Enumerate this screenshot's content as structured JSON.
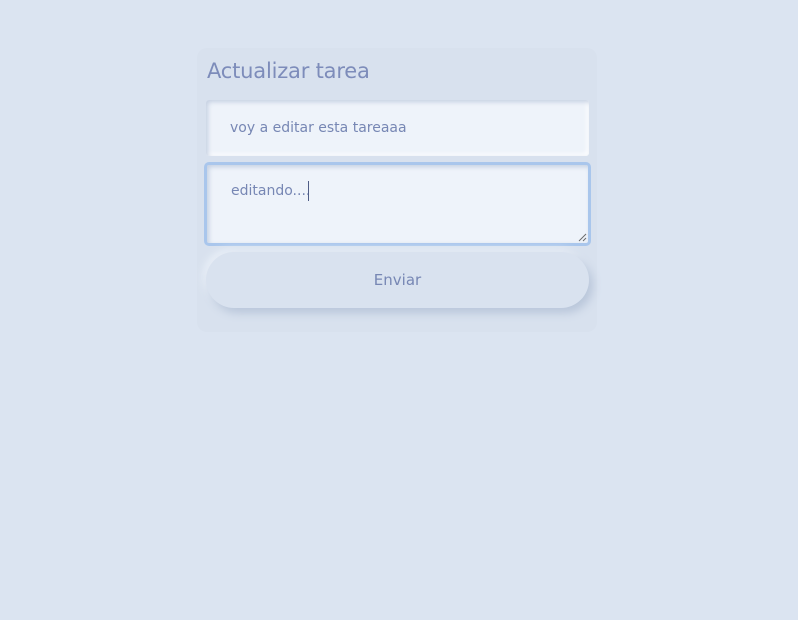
{
  "form": {
    "heading": "Actualizar tarea",
    "title_value": "voy a editar esta tareaaa",
    "description_value": "editando....",
    "submit_label": "Enviar"
  },
  "colors": {
    "background": "#dbe4f1",
    "text": "#7787b4",
    "focus_border": "#a9c6ec"
  }
}
